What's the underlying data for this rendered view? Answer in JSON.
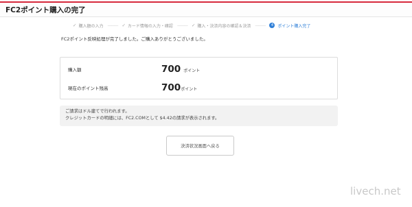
{
  "header": {
    "title": "FC2ポイント購入の完了"
  },
  "steps": [
    {
      "label": "購入額の入力",
      "state": "done"
    },
    {
      "label": "カード情報の入力・確認",
      "state": "done"
    },
    {
      "label": "購入・決済内容の確認＆決済",
      "state": "done"
    },
    {
      "number": "4",
      "label": "ポイント購入完了",
      "state": "active"
    }
  ],
  "message": "FC2ポイント反映処理が完了しました。ご購入ありがとうございました。",
  "summary": {
    "purchase": {
      "label": "購入額",
      "amount": "700",
      "unit": "ポイント"
    },
    "balance": {
      "label": "現在のポイント残高",
      "amount": "700",
      "unit": "ポイント"
    }
  },
  "notice": {
    "line1": "ご請求はドル建てで行われます。",
    "line2": "クレジットカードの明細には、FC2.COMとして $4.42の請求が表示されます。"
  },
  "back_button": {
    "label": "決済状況画面へ戻る"
  },
  "watermark": "livech.net",
  "colors": {
    "accent_red": "#d6273b",
    "active_blue": "#2f7fd7"
  }
}
